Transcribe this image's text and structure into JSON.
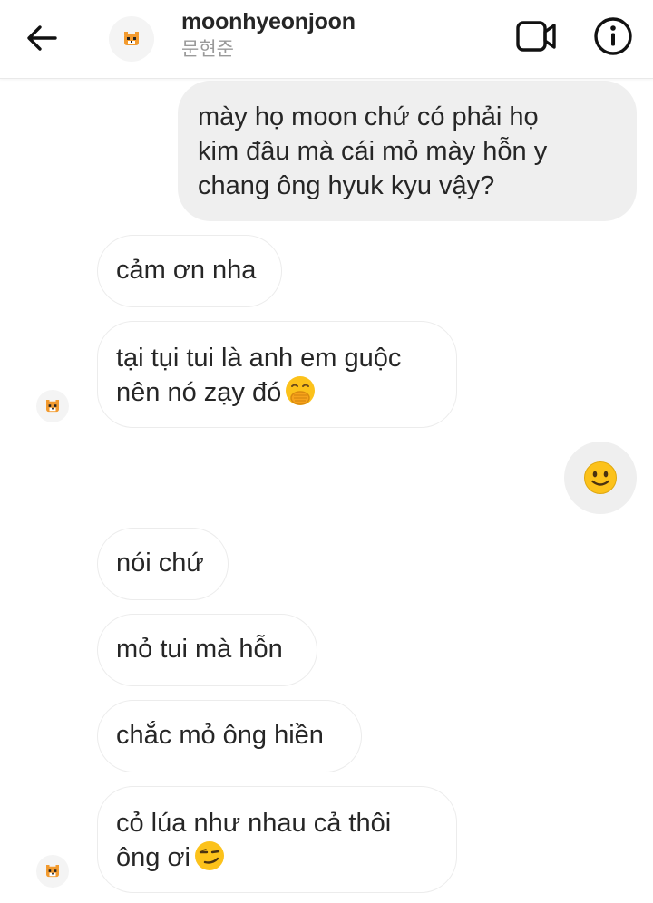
{
  "header": {
    "username": "moonhyeonjoon",
    "display_name": "문현준",
    "icons": {
      "back": "back-arrow-icon",
      "avatar": "tiger-avatar-icon",
      "video": "video-call-icon",
      "info": "info-icon"
    }
  },
  "messages": [
    {
      "sender": "me",
      "text": "mày họ moon chứ có phải họ\nkim đâu mà cái mỏ mày hỗn y\nchang ông hyuk kyu vậy?"
    },
    {
      "sender": "them",
      "text": "cảm ơn nha"
    },
    {
      "sender": "them",
      "text": "tại tụi tui là anh em guộc\nnên nó zạy đó",
      "emoji": "hand-over-mouth-emoji"
    },
    {
      "sender": "me",
      "text": "",
      "emoji": "slightly-smiling-face-emoji"
    },
    {
      "sender": "them",
      "text": "nói chứ"
    },
    {
      "sender": "them",
      "text": "mỏ tui mà hỗn"
    },
    {
      "sender": "them",
      "text": "chắc mỏ ông hiền"
    },
    {
      "sender": "them",
      "text": "cỏ lúa như nhau cả thôi\nông ơi",
      "emoji": "smirking-face-emoji"
    }
  ],
  "colors": {
    "sent_bubble": "#efefef",
    "received_border": "#ececec",
    "text": "#262626",
    "subtext": "#9a9a9a",
    "emoji_yellow": "#fcc21b"
  }
}
